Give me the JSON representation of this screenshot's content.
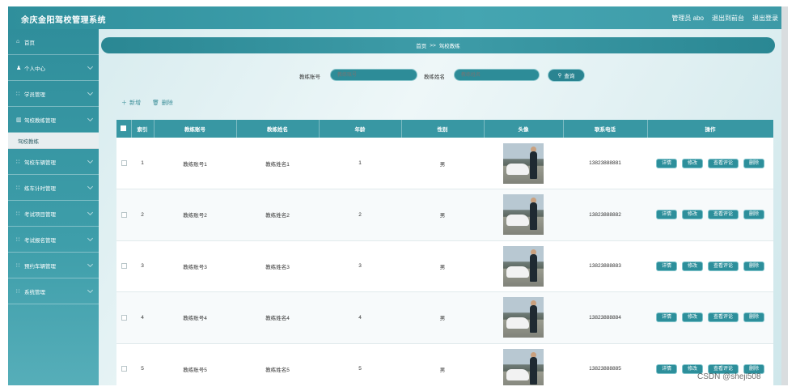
{
  "header": {
    "app_title": "余庆金阳驾校管理系统",
    "admin_label": "管理员 abo",
    "back_link": "退出到前台",
    "logout_link": "退出登录"
  },
  "sidebar": {
    "items": [
      {
        "label": "首页",
        "icon": "home-icon",
        "glyph": "⌂"
      },
      {
        "label": "个人中心",
        "icon": "user-icon",
        "glyph": "♟"
      },
      {
        "label": "学员管理",
        "icon": "grid-icon",
        "glyph": "∷"
      },
      {
        "label": "驾校教练管理",
        "icon": "chart-icon",
        "glyph": "▥"
      },
      {
        "label": "驾校车辆管理",
        "icon": "grid-icon",
        "glyph": "∷"
      },
      {
        "label": "练车计时管理",
        "icon": "grid-icon",
        "glyph": "∷"
      },
      {
        "label": "考试项目管理",
        "icon": "grid-icon",
        "glyph": "∷"
      },
      {
        "label": "考试报名管理",
        "icon": "grid-icon",
        "glyph": "∷"
      },
      {
        "label": "预约车辆管理",
        "icon": "grid-icon",
        "glyph": "∷"
      },
      {
        "label": "系统管理",
        "icon": "grid-icon",
        "glyph": "∷"
      }
    ],
    "active_sub": "驾校教练"
  },
  "breadcrumb": {
    "home": "首页",
    "sep": ">>",
    "current": "驾校教练"
  },
  "search": {
    "account_label": "教练账号",
    "account_placeholder": "教练账号",
    "name_label": "教练姓名",
    "name_placeholder": "教练姓名",
    "query_button": "查询"
  },
  "toolbar": {
    "add_label": "新增",
    "delete_label": "删除"
  },
  "table": {
    "headers": [
      "索引",
      "教练账号",
      "教练姓名",
      "年龄",
      "性别",
      "头像",
      "联系电话",
      "操作"
    ],
    "rows": [
      {
        "index": "1",
        "account": "教练账号1",
        "name": "教练姓名1",
        "age": "1",
        "gender": "男",
        "phone": "13823888881"
      },
      {
        "index": "2",
        "account": "教练账号2",
        "name": "教练姓名2",
        "age": "2",
        "gender": "男",
        "phone": "13823888882"
      },
      {
        "index": "3",
        "account": "教练账号3",
        "name": "教练姓名3",
        "age": "3",
        "gender": "男",
        "phone": "13823888883"
      },
      {
        "index": "4",
        "account": "教练账号4",
        "name": "教练姓名4",
        "age": "4",
        "gender": "男",
        "phone": "13823888884"
      },
      {
        "index": "5",
        "account": "教练账号5",
        "name": "教练姓名5",
        "age": "5",
        "gender": "男",
        "phone": "13823888885"
      }
    ],
    "actions": {
      "detail": "详情",
      "edit": "修改",
      "comments": "查看评论",
      "delete": "删除"
    }
  },
  "watermark": "CSDN @sheji508",
  "colors": {
    "brand": "#2f8f9c",
    "header_row": "#3897a3",
    "button": "#2d8f9b"
  }
}
